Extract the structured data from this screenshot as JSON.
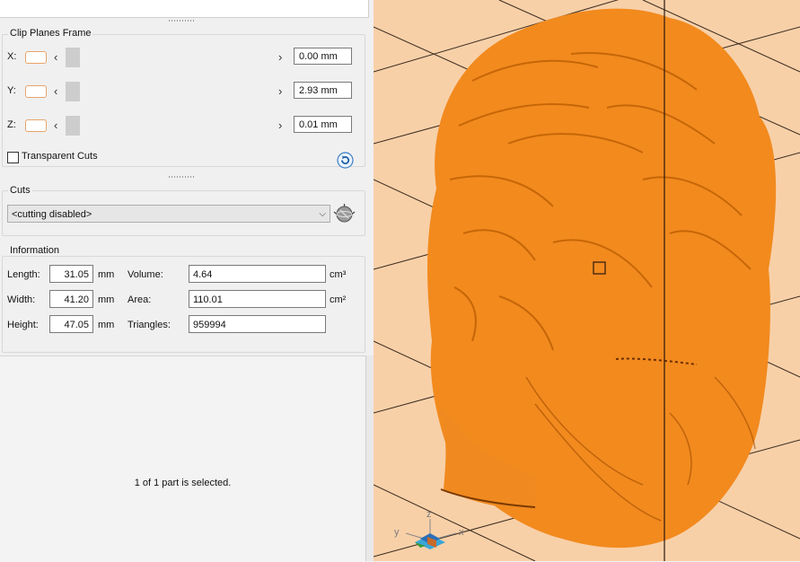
{
  "clip_planes": {
    "title": "Clip Planes Frame",
    "axes": [
      {
        "label": "X:",
        "value": "0.00 mm"
      },
      {
        "label": "Y:",
        "value": "2.93 mm"
      },
      {
        "label": "Z:",
        "value": "0.01 mm"
      }
    ],
    "transparent_cuts_label": "Transparent Cuts",
    "transparent_cuts_checked": false,
    "reset_icon": "reset-icon"
  },
  "cuts": {
    "title": "Cuts",
    "selected": "<cutting disabled>",
    "cut_icon": "cut-sphere-icon"
  },
  "information": {
    "title": "Information",
    "length_label": "Length:",
    "length_value": "31.05",
    "length_unit": "mm",
    "width_label": "Width:",
    "width_value": "41.20",
    "width_unit": "mm",
    "height_label": "Height:",
    "height_value": "47.05",
    "height_unit": "mm",
    "volume_label": "Volume:",
    "volume_value": "4.64",
    "volume_unit": "cm³",
    "area_label": "Area:",
    "area_value": "110.01",
    "area_unit": "cm²",
    "triangles_label": "Triangles:",
    "triangles_value": "959994"
  },
  "selection_status": "1 of 1 part is selected.",
  "viewport": {
    "background": "#f8d0a8",
    "model_color": "#f28a1e",
    "axis_labels": {
      "x": "x",
      "y": "y",
      "z": "z"
    }
  }
}
